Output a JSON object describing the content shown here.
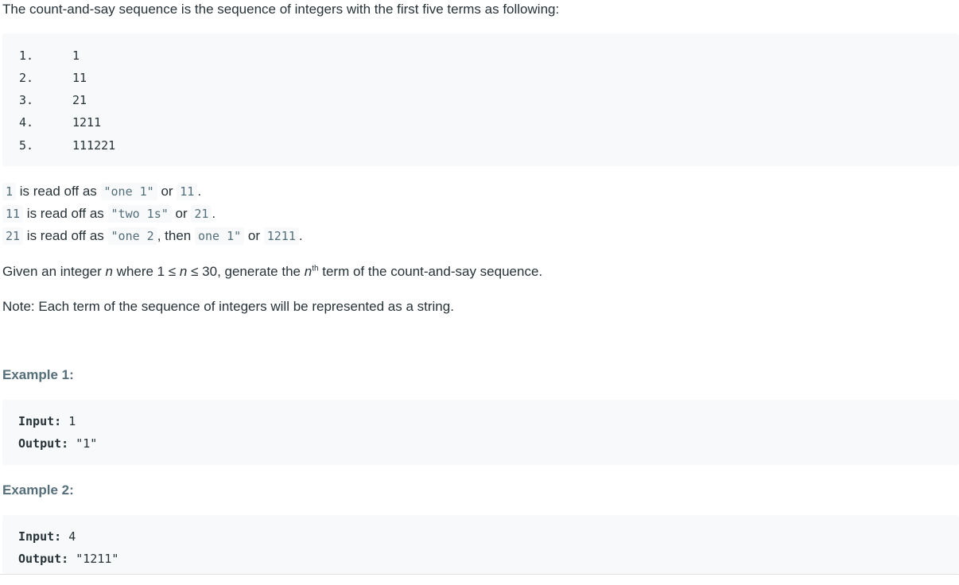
{
  "intro": "The count-and-say sequence is the sequence of integers with the first five terms as following:",
  "sequence": [
    {
      "index": "1.",
      "term": "1"
    },
    {
      "index": "2.",
      "term": "11"
    },
    {
      "index": "3.",
      "term": "21"
    },
    {
      "index": "4.",
      "term": "1211"
    },
    {
      "index": "5.",
      "term": "111221"
    }
  ],
  "read_off": [
    {
      "code1": "1",
      "mid1": " is read off as ",
      "code2": "\"one 1\"",
      "mid2": " or ",
      "code3": "11",
      "end": "."
    },
    {
      "code1": "11",
      "mid1": " is read off as ",
      "code2": "\"two 1s\"",
      "mid2": " or ",
      "code3": "21",
      "end": "."
    },
    {
      "code1": "21",
      "mid1": " is read off as ",
      "code2": "\"one 2",
      "mid2a": ", then ",
      "code2b": "one 1\"",
      "mid2": " or ",
      "code3": "1211",
      "end": "."
    }
  ],
  "given": {
    "pre": "Given an integer ",
    "n1": "n",
    "mid": " where 1 ≤ ",
    "n2": "n",
    "mid2": " ≤ 30, generate the ",
    "n3": "n",
    "sup": "th",
    "post": " term of the count-and-say sequence."
  },
  "note": "Note: Each term of the sequence of integers will be represented as a string.",
  "examples": [
    {
      "heading": "Example 1:",
      "input_label": "Input:",
      "input_value": " 1",
      "output_label": "Output:",
      "output_value": " \"1\""
    },
    {
      "heading": "Example 2:",
      "input_label": "Input:",
      "input_value": " 4",
      "output_label": "Output:",
      "output_value": " \"1211\""
    }
  ]
}
